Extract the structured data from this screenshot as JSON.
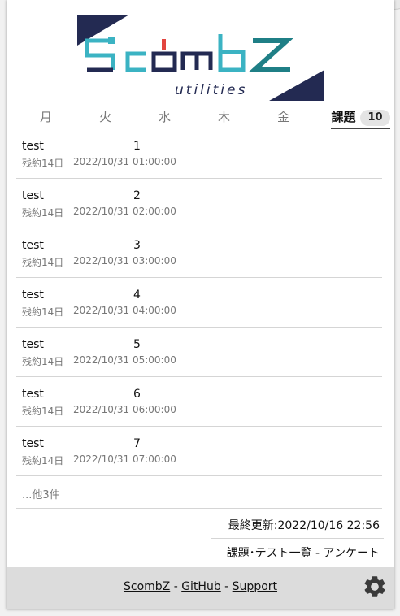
{
  "logo": {
    "primary": "ScombZ",
    "secondary": "utilities",
    "colors": {
      "navy": "#232a52",
      "teal": "#3bb3c3",
      "red": "#e2453f"
    }
  },
  "tabs": {
    "days": [
      "月",
      "火",
      "水",
      "木",
      "金"
    ],
    "tasks_label": "課題",
    "tasks_count": "10"
  },
  "tasks": [
    {
      "subject": "test",
      "title": "1",
      "remain": "残約14日",
      "deadline": "2022/10/31 01:00:00"
    },
    {
      "subject": "test",
      "title": "2",
      "remain": "残約14日",
      "deadline": "2022/10/31 02:00:00"
    },
    {
      "subject": "test",
      "title": "3",
      "remain": "残約14日",
      "deadline": "2022/10/31 03:00:00"
    },
    {
      "subject": "test",
      "title": "4",
      "remain": "残約14日",
      "deadline": "2022/10/31 04:00:00"
    },
    {
      "subject": "test",
      "title": "5",
      "remain": "残約14日",
      "deadline": "2022/10/31 05:00:00"
    },
    {
      "subject": "test",
      "title": "6",
      "remain": "残約14日",
      "deadline": "2022/10/31 06:00:00"
    },
    {
      "subject": "test",
      "title": "7",
      "remain": "残約14日",
      "deadline": "2022/10/31 07:00:00"
    }
  ],
  "more_text": "...他3件",
  "last_updated": "最終更新:2022/10/16 22:56",
  "quick_links": {
    "tasks_tests": "課題･テスト一覧",
    "separator": " - ",
    "survey": "アンケート"
  },
  "footer": {
    "scombz": "ScombZ",
    "github": "GitHub",
    "support": "Support",
    "separator": " - ",
    "gear_icon": "gear-icon"
  }
}
